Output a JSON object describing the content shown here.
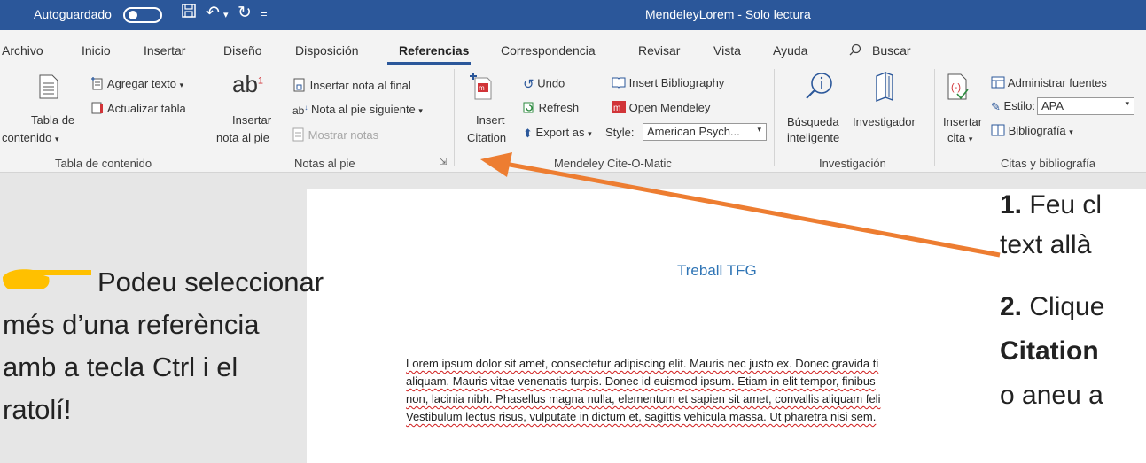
{
  "titlebar": {
    "autosave_label": "Autoguardado",
    "title": "MendeleyLorem  -  Solo lectura"
  },
  "tabs": [
    "Archivo",
    "Inicio",
    "Insertar",
    "Diseño",
    "Disposición",
    "Referencias",
    "Correspondencia",
    "Revisar",
    "Vista",
    "Ayuda"
  ],
  "search": {
    "label": "Buscar"
  },
  "ribbon": {
    "toc": {
      "button": "Tabla de contenido",
      "line1": "Tabla de",
      "line2": "contenido",
      "add_text": "Agregar texto",
      "update_table": "Actualizar tabla",
      "group": "Tabla de contenido"
    },
    "footnotes": {
      "insert_line1": "Insertar",
      "insert_line2": "nota al pie",
      "insert_endnote": "Insertar nota al final",
      "next_footnote": "Nota al pie siguiente",
      "show_notes": "Mostrar notas",
      "group": "Notas al pie"
    },
    "mendeley": {
      "insert_line1": "Insert",
      "insert_line2": "Citation",
      "undo": "Undo",
      "refresh": "Refresh",
      "export": "Export as",
      "insert_bibliography": "Insert Bibliography",
      "open_mendeley": "Open Mendeley",
      "style_label": "Style:",
      "style_value": "American Psych...",
      "group": "Mendeley Cite-O-Matic"
    },
    "research": {
      "smart_line1": "Búsqueda",
      "smart_line2": "inteligente",
      "researcher": "Investigador",
      "group": "Investigación"
    },
    "citations": {
      "insert_line1": "Insertar",
      "insert_line2": "cita",
      "manage_sources": "Administrar fuentes",
      "style_label": "Estilo:",
      "style_value": "APA",
      "bibliography": "Bibliografía",
      "group": "Citas y bibliografía"
    }
  },
  "document": {
    "title": "Treball TFG",
    "lines": [
      "Lorem ipsum dolor sit amet, consectetur adipiscing elit. Mauris nec justo ex. Donec gravida ti",
      "aliquam. Mauris vitae venenatis turpis. Donec id euismod ipsum. Etiam in elit tempor, finibus",
      "non, lacinia nibh. Phasellus magna nulla, elementum et sapien sit amet, convallis aliquam feli",
      "Vestibulum lectus risus, vulputate in dictum et, sagittis vehicula massa. Ut pharetra nisi sem."
    ]
  },
  "callouts": {
    "tip_line1": "Podeu seleccionar",
    "tip_line2": "més d’una referència",
    "tip_line3": "amb a tecla Ctrl i el",
    "tip_line4": "ratolí!",
    "step1_num": "1.",
    "step1_a": "Feu cl",
    "step1_b": "text allà",
    "step2_num": "2.",
    "step2_a": "Clique",
    "step2_b": "Citation",
    "step2_c": "o aneu a"
  },
  "colors": {
    "title_bar": "#2b579a",
    "arrow": "#ed7d31",
    "doc_title": "#2e74b5"
  }
}
